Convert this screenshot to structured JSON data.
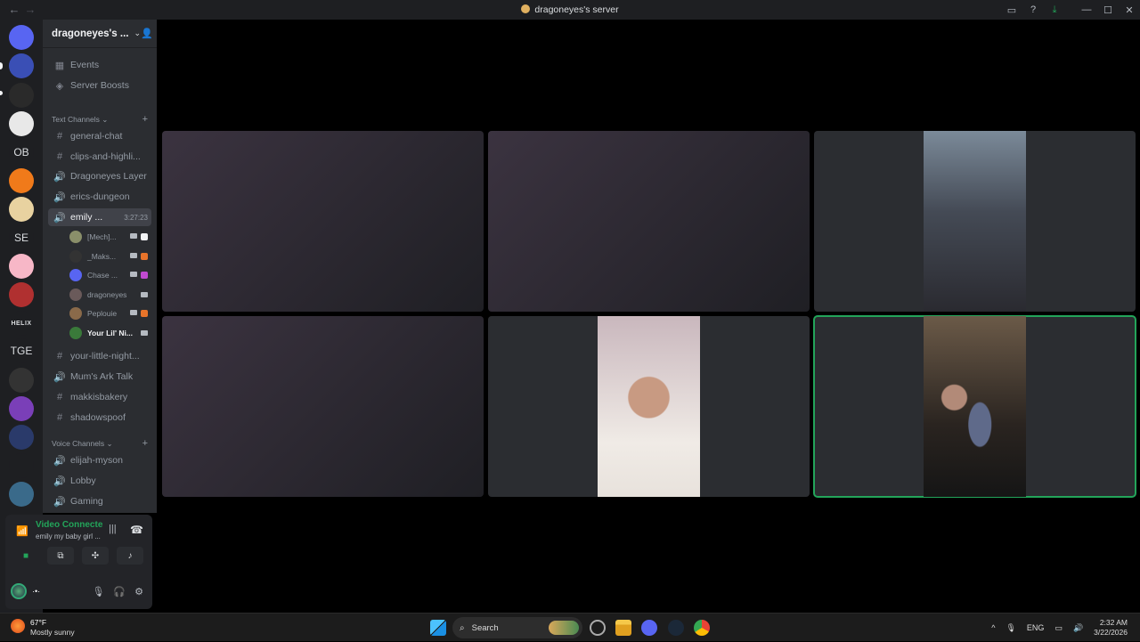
{
  "window": {
    "title": "dragoneyes's server",
    "back_icon": "←",
    "forward_icon": "→"
  },
  "titlebar_icons": {
    "inbox": "▭",
    "help": "?",
    "download": "⤓",
    "minimize": "—",
    "maximize": "☐",
    "close": "✕"
  },
  "guilds": [
    {
      "label": "",
      "color": "#5865f2",
      "kind": "home"
    },
    {
      "label": "",
      "color": "#3a4fb5"
    },
    {
      "label": "",
      "color": "#2a2a2a"
    },
    {
      "label": "",
      "color": "#e8e8e8"
    },
    {
      "label": "OB",
      "color": "#1e1f22"
    },
    {
      "label": "",
      "color": "#f07a1a"
    },
    {
      "label": "",
      "color": "#e8d2a0"
    },
    {
      "label": "SE",
      "color": "#1e1f22"
    },
    {
      "label": "",
      "color": "#f7b7c7"
    },
    {
      "label": "",
      "color": "#b03030"
    },
    {
      "label": "HELIX",
      "color": "#1e1f22"
    },
    {
      "label": "TGE",
      "color": "#1e1f22"
    },
    {
      "label": "",
      "color": "#333"
    },
    {
      "label": "",
      "color": "#7a3fb8"
    },
    {
      "label": "",
      "color": "#2a3a6a"
    },
    {
      "label": "",
      "color": "#1e1f22"
    },
    {
      "label": "",
      "color": "#3a6a8a"
    }
  ],
  "server": {
    "name": "dragoneyes's ...",
    "events": "Events",
    "boosts": "Server Boosts",
    "text_category": "Text Channels",
    "voice_category": "Voice Channels"
  },
  "text_channels_top": [
    "general-chat",
    "clips-and-highli..."
  ],
  "voice_channels_a": [
    "Dragoneyes Layer",
    "erics-dungeon"
  ],
  "active_channel": {
    "name": "emily ...",
    "timer": "3:27:23"
  },
  "voice_users": [
    {
      "name": "[Mech]...",
      "color": "#8a8f6a",
      "act": "#f2f3f5"
    },
    {
      "name": "_Maks...",
      "color": "#333",
      "act": "#e8742a"
    },
    {
      "name": "Chase ...",
      "color": "#5865f2",
      "act": "#c04ad0"
    },
    {
      "name": "dragoneyes",
      "color": "#6a5a5a",
      "act": ""
    },
    {
      "name": "Peplouie",
      "color": "#8a6a4a",
      "act": "#e8742a"
    },
    {
      "name": "Your Lil' Ni...",
      "color": "#3a7a3a",
      "act": ""
    }
  ],
  "text_channels_bottom": [
    "your-little-night...",
    "Mum's Ark Talk",
    "makkisbakery",
    "shadowspoof"
  ],
  "voice_channels_b": [
    "elijah-myson",
    "Lobby",
    "Gaming"
  ],
  "voice_panel": {
    "status": "Video Connecte",
    "channel": "emily my baby girl ..."
  },
  "user_panel": {
    "name": "·•·"
  },
  "taskbar": {
    "temp": "67°F",
    "condition": "Mostly sunny",
    "search": "Search",
    "lang": "ENG",
    "time": "2:32 AM",
    "date": "3/22/2026"
  }
}
